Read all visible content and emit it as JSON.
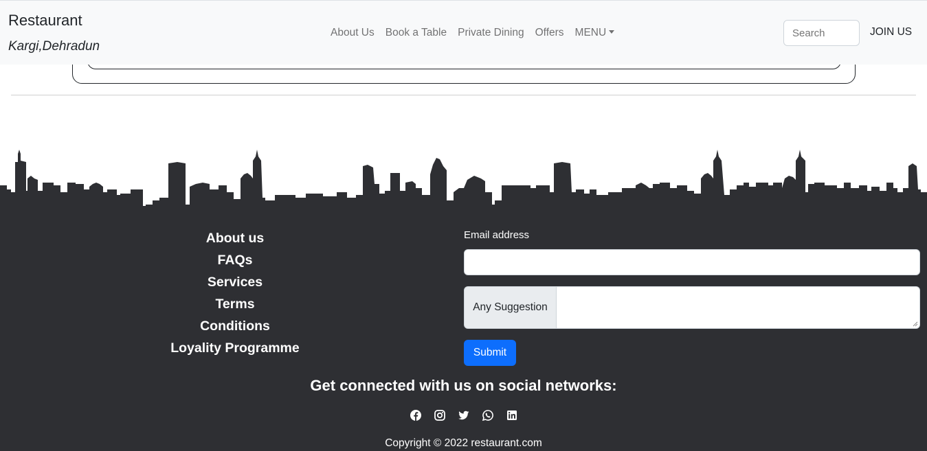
{
  "navbar": {
    "brand": "Restaurant",
    "brand_sub": "Kargi,Dehradun",
    "links": [
      "About Us",
      "Book a Table",
      "Private Dining",
      "Offers"
    ],
    "menu_label": "MENU",
    "search_placeholder": "Search",
    "join_label": "JOIN US"
  },
  "footer": {
    "links": [
      "About us",
      "FAQs",
      "Services",
      "Terms",
      "Conditions",
      "Loyality Programme"
    ],
    "form": {
      "email_label": "Email address",
      "email_value": "",
      "suggestion_label": "Any Suggestion",
      "suggestion_value": "",
      "submit_label": "Submit"
    },
    "social_heading": "Get connected with us on social networks:",
    "social_icons": [
      "facebook-icon",
      "instagram-icon",
      "twitter-icon",
      "whatsapp-icon",
      "linkedin-icon"
    ],
    "copyright": "Copyright © 2022 restaurant.com"
  },
  "colors": {
    "footer_bg": "#2e2f33",
    "navbar_bg": "#f8f9fa",
    "accent": "#0d6efd"
  }
}
